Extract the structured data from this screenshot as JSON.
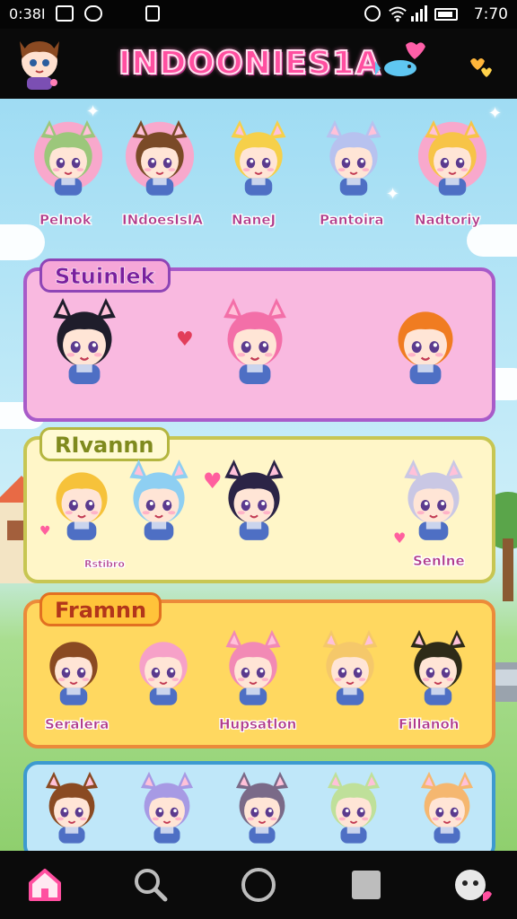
{
  "status_bar": {
    "left_time": "0:38I",
    "right_time": "7:70",
    "icons": [
      "photo-icon",
      "location-icon",
      "gallery-icon",
      "alarm-icon",
      "wifi-icon",
      "signal-icon",
      "battery-icon"
    ]
  },
  "header": {
    "title": "INDOONIES1A",
    "avatar": "avatar-fox-boy",
    "decor": [
      "fish-icon",
      "hearts-icon"
    ]
  },
  "top_row": [
    {
      "label": "PeInok",
      "hair": "#9cc77b",
      "skin": "#ffe1d0",
      "bg": "#f8a8cc",
      "ears": true
    },
    {
      "label": "INdoesIsIA",
      "hair": "#7a4a27",
      "skin": "#ffe1d0",
      "bg": "#f8a8cc",
      "ears": true
    },
    {
      "label": "NaneJ",
      "hair": "#f6d04a",
      "skin": "#ffe1d0",
      "bg": "none",
      "ears": true
    },
    {
      "label": "Pantoira",
      "hair": "#b7c2ef",
      "skin": "#ffe1d0",
      "bg": "none",
      "ears": true
    },
    {
      "label": "Nadtoriy",
      "hair": "#f7c447",
      "skin": "#ffe1d0",
      "bg": "#f8a8cc",
      "ears": true
    }
  ],
  "sections": [
    {
      "title": "Stuinlek",
      "theme": "pink",
      "characters": [
        {
          "hair": "#1f1d2b",
          "ears": true,
          "label": ""
        },
        {
          "hair": "#f36fa8",
          "ears": true,
          "label": ""
        },
        {
          "hair": "#f07c21",
          "ears": false,
          "label": ""
        }
      ]
    },
    {
      "title": "RIvannn",
      "theme": "cream",
      "characters": [
        {
          "hair": "#f6c23a",
          "ears": false,
          "label": "Rstibro"
        },
        {
          "hair": "#8ecff2",
          "ears": true,
          "label": ""
        },
        {
          "hair": "#2b2446",
          "ears": true,
          "label": ""
        },
        {
          "hair": "#c9c7e4",
          "ears": true,
          "label": "Senlne"
        }
      ]
    },
    {
      "title": "Framnn",
      "theme": "orange",
      "characters": [
        {
          "hair": "#8a4a22",
          "ears": false,
          "label": "Seralera"
        },
        {
          "hair": "#f6a1c8",
          "ears": false,
          "label": ""
        },
        {
          "hair": "#f28ab5",
          "ears": true,
          "label": "Hupsatlon"
        },
        {
          "hair": "#f5c86a",
          "ears": true,
          "label": ""
        },
        {
          "hair": "#2e2b18",
          "ears": true,
          "label": "Fillanoh"
        }
      ]
    },
    {
      "title": "",
      "theme": "blue",
      "characters": [
        {
          "hair": "#8a4a22",
          "ears": true,
          "label": ""
        },
        {
          "hair": "#a79ae4",
          "ears": true,
          "label": ""
        },
        {
          "hair": "#7a6a88",
          "ears": true,
          "label": ""
        },
        {
          "hair": "#bfe09a",
          "ears": true,
          "label": ""
        },
        {
          "hair": "#f5b770",
          "ears": true,
          "label": ""
        }
      ]
    }
  ],
  "bottom_nav": [
    {
      "icon": "home-icon",
      "active": true
    },
    {
      "icon": "search-icon",
      "active": false
    },
    {
      "icon": "home-circle-icon",
      "active": false
    },
    {
      "icon": "square-icon",
      "active": false
    },
    {
      "icon": "chat-face-icon",
      "active": false
    }
  ]
}
